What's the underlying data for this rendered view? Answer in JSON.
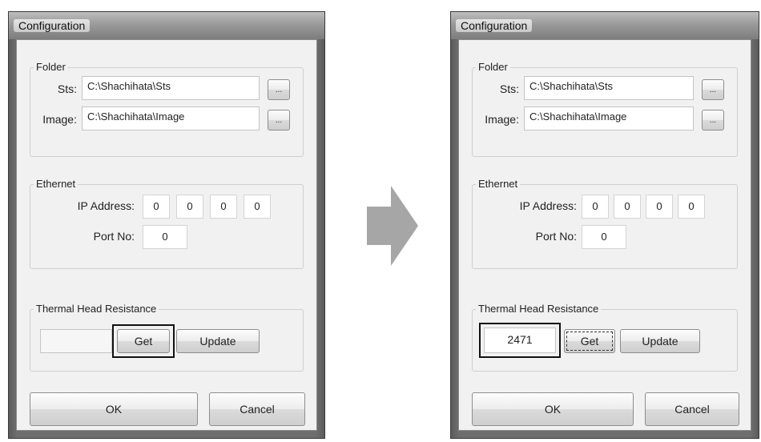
{
  "left_dialog": {
    "title": "Configuration",
    "folder": {
      "label": "Folder",
      "sts_label": "Sts:",
      "sts_value": "C:\\Shachihata\\Sts",
      "image_label": "Image:",
      "image_value": "C:\\Shachihata\\Image",
      "browse_label": "..."
    },
    "ethernet": {
      "label": "Ethernet",
      "ip_label": "IP Address:",
      "ip_octets": [
        "0",
        "0",
        "0",
        "0"
      ],
      "port_label": "Port No:",
      "port_value": "0"
    },
    "thermal": {
      "label": "Thermal Head Resistance",
      "value": "",
      "get_label": "Get",
      "update_label": "Update"
    },
    "ok_label": "OK",
    "cancel_label": "Cancel"
  },
  "right_dialog": {
    "title": "Configuration",
    "folder": {
      "label": "Folder",
      "sts_label": "Sts:",
      "sts_value": "C:\\Shachihata\\Sts",
      "image_label": "Image:",
      "image_value": "C:\\Shachihata\\Image",
      "browse_label": "..."
    },
    "ethernet": {
      "label": "Ethernet",
      "ip_label": "IP Address:",
      "ip_octets": [
        "0",
        "0",
        "0",
        "0"
      ],
      "port_label": "Port No:",
      "port_value": "0"
    },
    "thermal": {
      "label": "Thermal Head Resistance",
      "value": "2471",
      "get_label": "Get",
      "update_label": "Update"
    },
    "ok_label": "OK",
    "cancel_label": "Cancel"
  },
  "colors": {
    "arrow": "#a6a6a6",
    "dialog_frame": "#6e6e6e",
    "client_bg": "#f1f1f1"
  }
}
